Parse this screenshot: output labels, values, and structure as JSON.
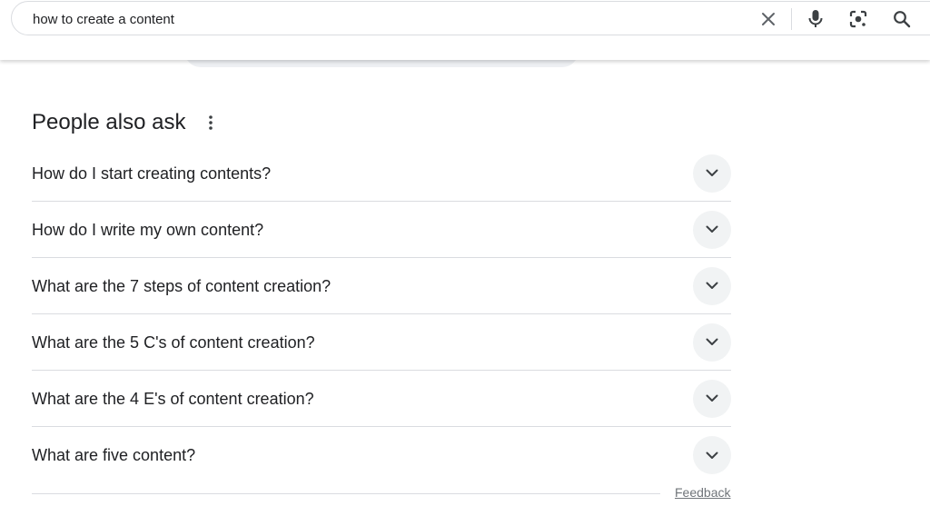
{
  "search": {
    "query": "how to create a content",
    "icons": {
      "clear": "close-icon",
      "voice": "microphone-icon",
      "lens": "camera-lens-icon",
      "search": "search-icon"
    }
  },
  "people_also_ask": {
    "title": "People also ask",
    "questions": [
      "How do I start creating contents?",
      "How do I write my own content?",
      "What are the 7 steps of content creation?",
      "What are the 5 C's of content creation?",
      "What are the 4 E's of content creation?",
      "What are five content?"
    ]
  },
  "footer": {
    "feedback_label": "Feedback"
  },
  "colors": {
    "text": "#202124",
    "divider": "#dadce0",
    "chevron_bg": "#f1f3f4",
    "muted": "#70757a"
  }
}
